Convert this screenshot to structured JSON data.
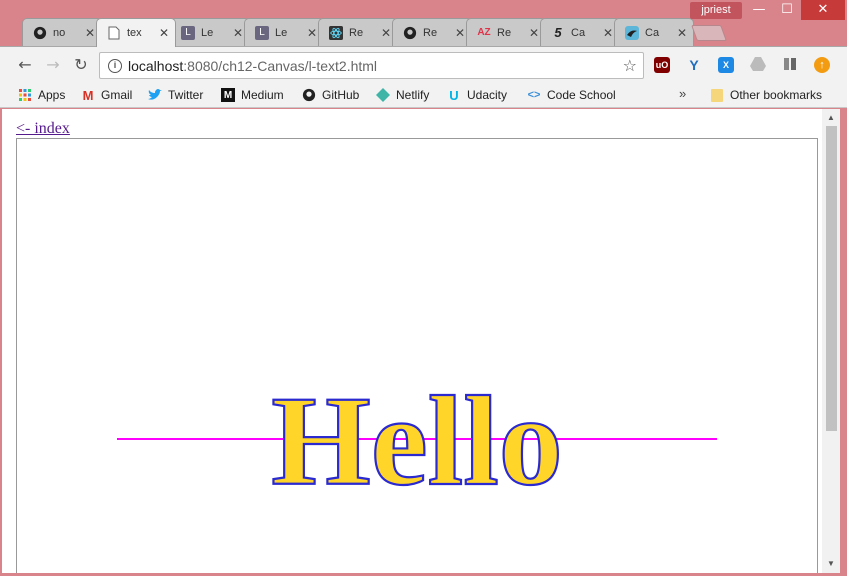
{
  "window": {
    "profile_name": "jpriest",
    "minimize_icon": "minimize-icon",
    "maximize_icon": "maximize-icon",
    "close_icon": "close-icon"
  },
  "tabs": [
    {
      "label": "no",
      "icon": "github-icon",
      "active": false
    },
    {
      "label": "tex",
      "icon": "page-icon",
      "active": true
    },
    {
      "label": "Le",
      "icon": "le-icon",
      "active": false
    },
    {
      "label": "Le",
      "icon": "le-icon",
      "active": false
    },
    {
      "label": "Re",
      "icon": "react-icon",
      "active": false
    },
    {
      "label": "Re",
      "icon": "github-icon",
      "active": false
    },
    {
      "label": "Re",
      "icon": "az-icon",
      "active": false
    },
    {
      "label": "Ca",
      "icon": "five-icon",
      "active": false
    },
    {
      "label": "Ca",
      "icon": "bird-icon",
      "active": false
    }
  ],
  "toolbar": {
    "url_host": "localhost",
    "url_rest": ":8080/ch12-Canvas/l-text2.html"
  },
  "bookmarks": [
    {
      "label": "Apps",
      "icon": "apps-icon"
    },
    {
      "label": "Gmail",
      "icon": "gmail-icon"
    },
    {
      "label": "Twitter",
      "icon": "twitter-icon"
    },
    {
      "label": "Medium",
      "icon": "medium-icon"
    },
    {
      "label": "GitHub",
      "icon": "github-icon"
    },
    {
      "label": "Netlify",
      "icon": "netlify-icon"
    },
    {
      "label": "Udacity",
      "icon": "udacity-icon"
    },
    {
      "label": "Code School",
      "icon": "codeschool-icon"
    }
  ],
  "bookmarks_more": "»",
  "other_bookmarks": "Other bookmarks",
  "page": {
    "index_link": "<- index",
    "canvas_text": "Hello"
  },
  "colors": {
    "text_fill": "#ffd52a",
    "text_stroke": "#2a2ad0",
    "baseline": "#ff00ff"
  }
}
